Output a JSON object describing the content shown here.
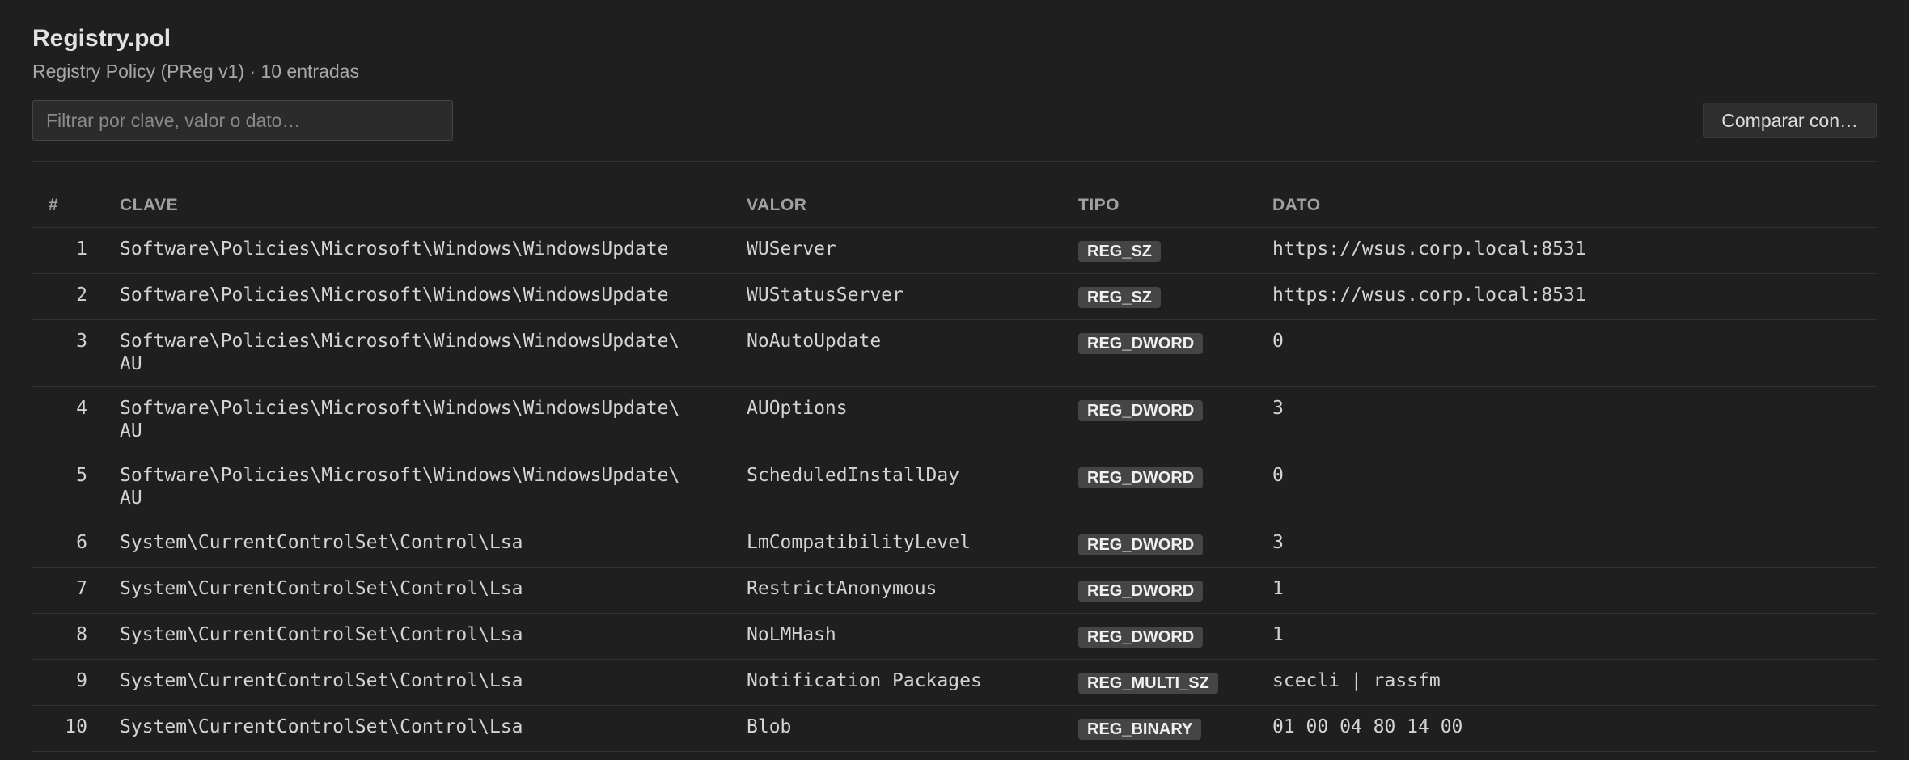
{
  "header": {
    "title": "Registry.pol",
    "subtitle": "Registry Policy (PReg v1) · 10 entradas"
  },
  "toolbar": {
    "filter_placeholder": "Filtrar por clave, valor o dato…",
    "filter_value": "",
    "compare_label": "Comparar con…"
  },
  "table": {
    "columns": {
      "num": "#",
      "key": "CLAVE",
      "value": "VALOR",
      "type": "TIPO",
      "data": "DATO"
    },
    "rows": [
      {
        "num": "1",
        "key": "Software\\Policies\\Microsoft\\Windows\\WindowsUpdate",
        "value": "WUServer",
        "type": "REG_SZ",
        "data": "https://wsus.corp.local:8531"
      },
      {
        "num": "2",
        "key": "Software\\Policies\\Microsoft\\Windows\\WindowsUpdate",
        "value": "WUStatusServer",
        "type": "REG_SZ",
        "data": "https://wsus.corp.local:8531"
      },
      {
        "num": "3",
        "key": "Software\\Policies\\Microsoft\\Windows\\WindowsUpdate\\\nAU",
        "value": "NoAutoUpdate",
        "type": "REG_DWORD",
        "data": "0"
      },
      {
        "num": "4",
        "key": "Software\\Policies\\Microsoft\\Windows\\WindowsUpdate\\\nAU",
        "value": "AUOptions",
        "type": "REG_DWORD",
        "data": "3"
      },
      {
        "num": "5",
        "key": "Software\\Policies\\Microsoft\\Windows\\WindowsUpdate\\\nAU",
        "value": "ScheduledInstallDay",
        "type": "REG_DWORD",
        "data": "0"
      },
      {
        "num": "6",
        "key": "System\\CurrentControlSet\\Control\\Lsa",
        "value": "LmCompatibilityLevel",
        "type": "REG_DWORD",
        "data": "3"
      },
      {
        "num": "7",
        "key": "System\\CurrentControlSet\\Control\\Lsa",
        "value": "RestrictAnonymous",
        "type": "REG_DWORD",
        "data": "1"
      },
      {
        "num": "8",
        "key": "System\\CurrentControlSet\\Control\\Lsa",
        "value": "NoLMHash",
        "type": "REG_DWORD",
        "data": "1"
      },
      {
        "num": "9",
        "key": "System\\CurrentControlSet\\Control\\Lsa",
        "value": "Notification Packages",
        "type": "REG_MULTI_SZ",
        "data": "scecli | rassfm"
      },
      {
        "num": "10",
        "key": "System\\CurrentControlSet\\Control\\Lsa",
        "value": "Blob",
        "type": "REG_BINARY",
        "data": "01 00 04 80 14 00"
      }
    ]
  }
}
